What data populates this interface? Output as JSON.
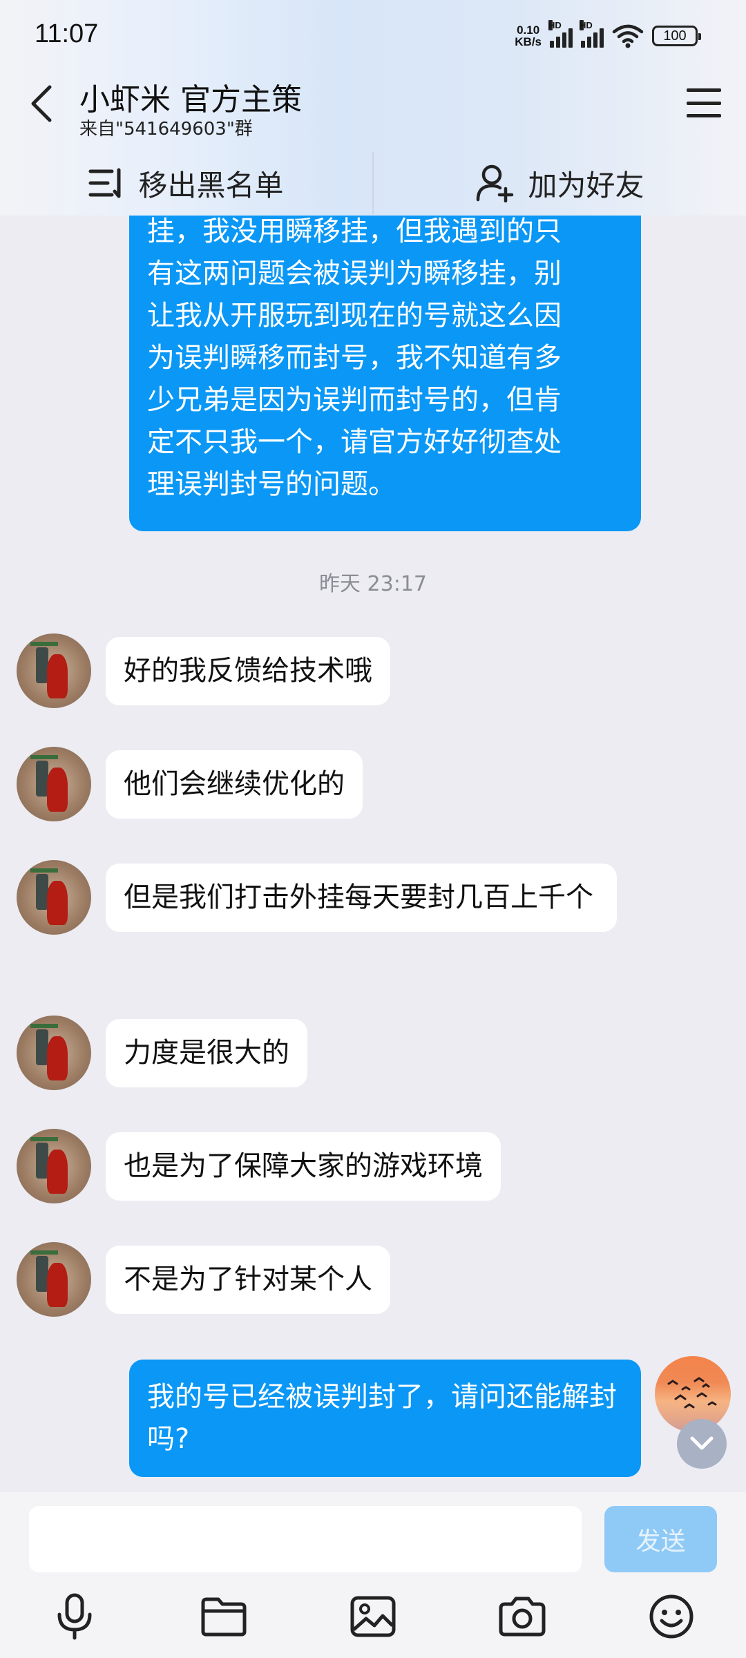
{
  "status_bar": {
    "time": "11:07",
    "net_speed_value": "0.10",
    "net_speed_unit": "KB/s",
    "sim1_label": "HD",
    "sim2_label": "HD",
    "battery": "100"
  },
  "header": {
    "title": "小虾米 官方主策",
    "subtitle": "来自\"541649603\"群"
  },
  "actions": {
    "remove_blacklist": "移出黑名单",
    "add_friend": "加为好友"
  },
  "messages": {
    "first_outgoing_lines": [
      "挂，我没用瞬移挂，但我遇到的只",
      "有这两问题会被误判为瞬移挂，别",
      "让我从开服玩到现在的号就这么因",
      "为误判瞬移而封号，我不知道有多",
      "少兄弟是因为误判而封号的，但肯",
      "定不只我一个，请官方好好彻查处",
      "理误判封号的问题。"
    ],
    "timestamp": "昨天 23:17",
    "incoming": [
      "好的我反馈给技术哦",
      "他们会继续优化的",
      "但是我们打击外挂每天要封几百上千个",
      "力度是很大的",
      "也是为了保障大家的游戏环境",
      "不是为了针对某个人"
    ],
    "last_outgoing": "我的号已经被误判封了，请问还能解封吗?"
  },
  "input": {
    "placeholder": "",
    "send_label": "发送"
  },
  "icons": {
    "back": "chevron-left-icon",
    "menu": "hamburger-menu-icon",
    "remove_blacklist": "list-sort-icon",
    "add_friend": "add-user-icon",
    "scroll_down": "chevron-down-icon",
    "voice": "microphone-icon",
    "file": "folder-icon",
    "image": "image-icon",
    "camera": "camera-icon",
    "emoji": "smiley-icon"
  },
  "colors": {
    "outgoing_bubble": "#0a97f5",
    "incoming_bubble": "#ffffff",
    "chat_background": "#ececf2",
    "send_button": "#8fcaf7"
  }
}
